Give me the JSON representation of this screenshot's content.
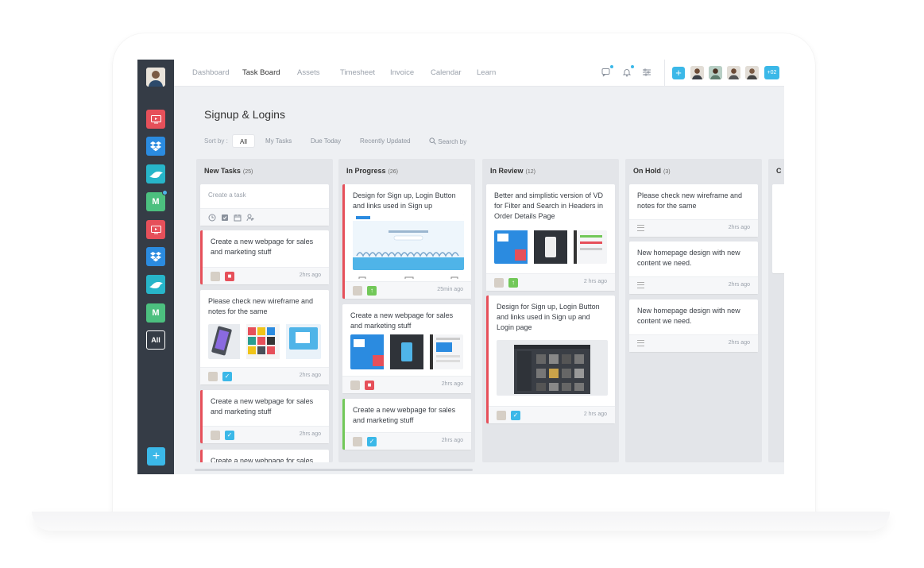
{
  "nav": {
    "items": [
      "Dashboard",
      "Task Board",
      "Assets",
      "Timesheet",
      "Invoice",
      "Calendar",
      "Learn"
    ],
    "active": "Task Board"
  },
  "topbar": {
    "more_members": "+02",
    "add_label": "+"
  },
  "sidebar": {
    "apps": [
      {
        "icon": "screen-app-icon",
        "color": "#e6505a"
      },
      {
        "icon": "dropbox-icon",
        "color": "#2b8be0"
      },
      {
        "icon": "whale-app-icon",
        "color": "#27b5c9"
      },
      {
        "icon": "m-app-icon",
        "color": "#4cc07f",
        "label": "M"
      },
      {
        "icon": "screen-app-icon",
        "color": "#e6505a"
      },
      {
        "icon": "dropbox-icon",
        "color": "#2b8be0"
      },
      {
        "icon": "whale-app-icon",
        "color": "#27b5c9"
      },
      {
        "icon": "m-app-icon",
        "color": "#4cc07f",
        "label": "M"
      }
    ],
    "all_label": "All",
    "add_label": "+"
  },
  "page": {
    "title": "Signup & Logins"
  },
  "sort": {
    "label": "Sort by :",
    "options": [
      "All",
      "My Tasks",
      "Due Today",
      "Recently Updated"
    ],
    "active": "All",
    "search_label": "Search by"
  },
  "columns": [
    {
      "title": "New Tasks",
      "count": "(25)"
    },
    {
      "title": "In Progress",
      "count": "(26)"
    },
    {
      "title": "In Review",
      "count": "(12)"
    },
    {
      "title": "On Hold",
      "count": "(3)"
    },
    {
      "title": "C",
      "count": ""
    }
  ],
  "cards": {
    "create_placeholder": "Create a task",
    "new_tasks": [
      {
        "title": "Create a new webpage for sales and marketing stuff",
        "time": "2hrs ago"
      },
      {
        "title": "Please check new wireframe and notes for the same",
        "time": "2hrs ago"
      },
      {
        "title": "Create a new webpage for sales and marketing stuff",
        "time": "2hrs ago"
      },
      {
        "title": "Create a new webpage for sales",
        "time": ""
      }
    ],
    "in_progress": [
      {
        "title": "Design for Sign up, Login Button and links used in Sign up",
        "time": "25min ago"
      },
      {
        "title": "Create a new webpage for sales and marketing stuff",
        "time": "2hrs ago"
      },
      {
        "title": "Create a new webpage for sales and marketing stuff",
        "time": "2hrs ago"
      }
    ],
    "in_review": [
      {
        "title": "Better and simplistic version of VD for Filter and Search in Headers in Order Details Page",
        "time": "2 hrs ago"
      },
      {
        "title": "Design for Sign up, Login Button and links used in Sign up and Login page",
        "time": "2 hrs ago"
      }
    ],
    "on_hold": [
      {
        "title": "Please check new wireframe and notes for the same",
        "time": "2hrs ago"
      },
      {
        "title": "New homepage design with new content we need.",
        "time": "2hrs ago"
      },
      {
        "title": "New homepage design with new content we need.",
        "time": "2hrs ago"
      }
    ]
  },
  "colors": {
    "accent": "#3bb8e8",
    "red": "#e6505a",
    "green": "#72c859",
    "sidebar": "#353c46"
  }
}
